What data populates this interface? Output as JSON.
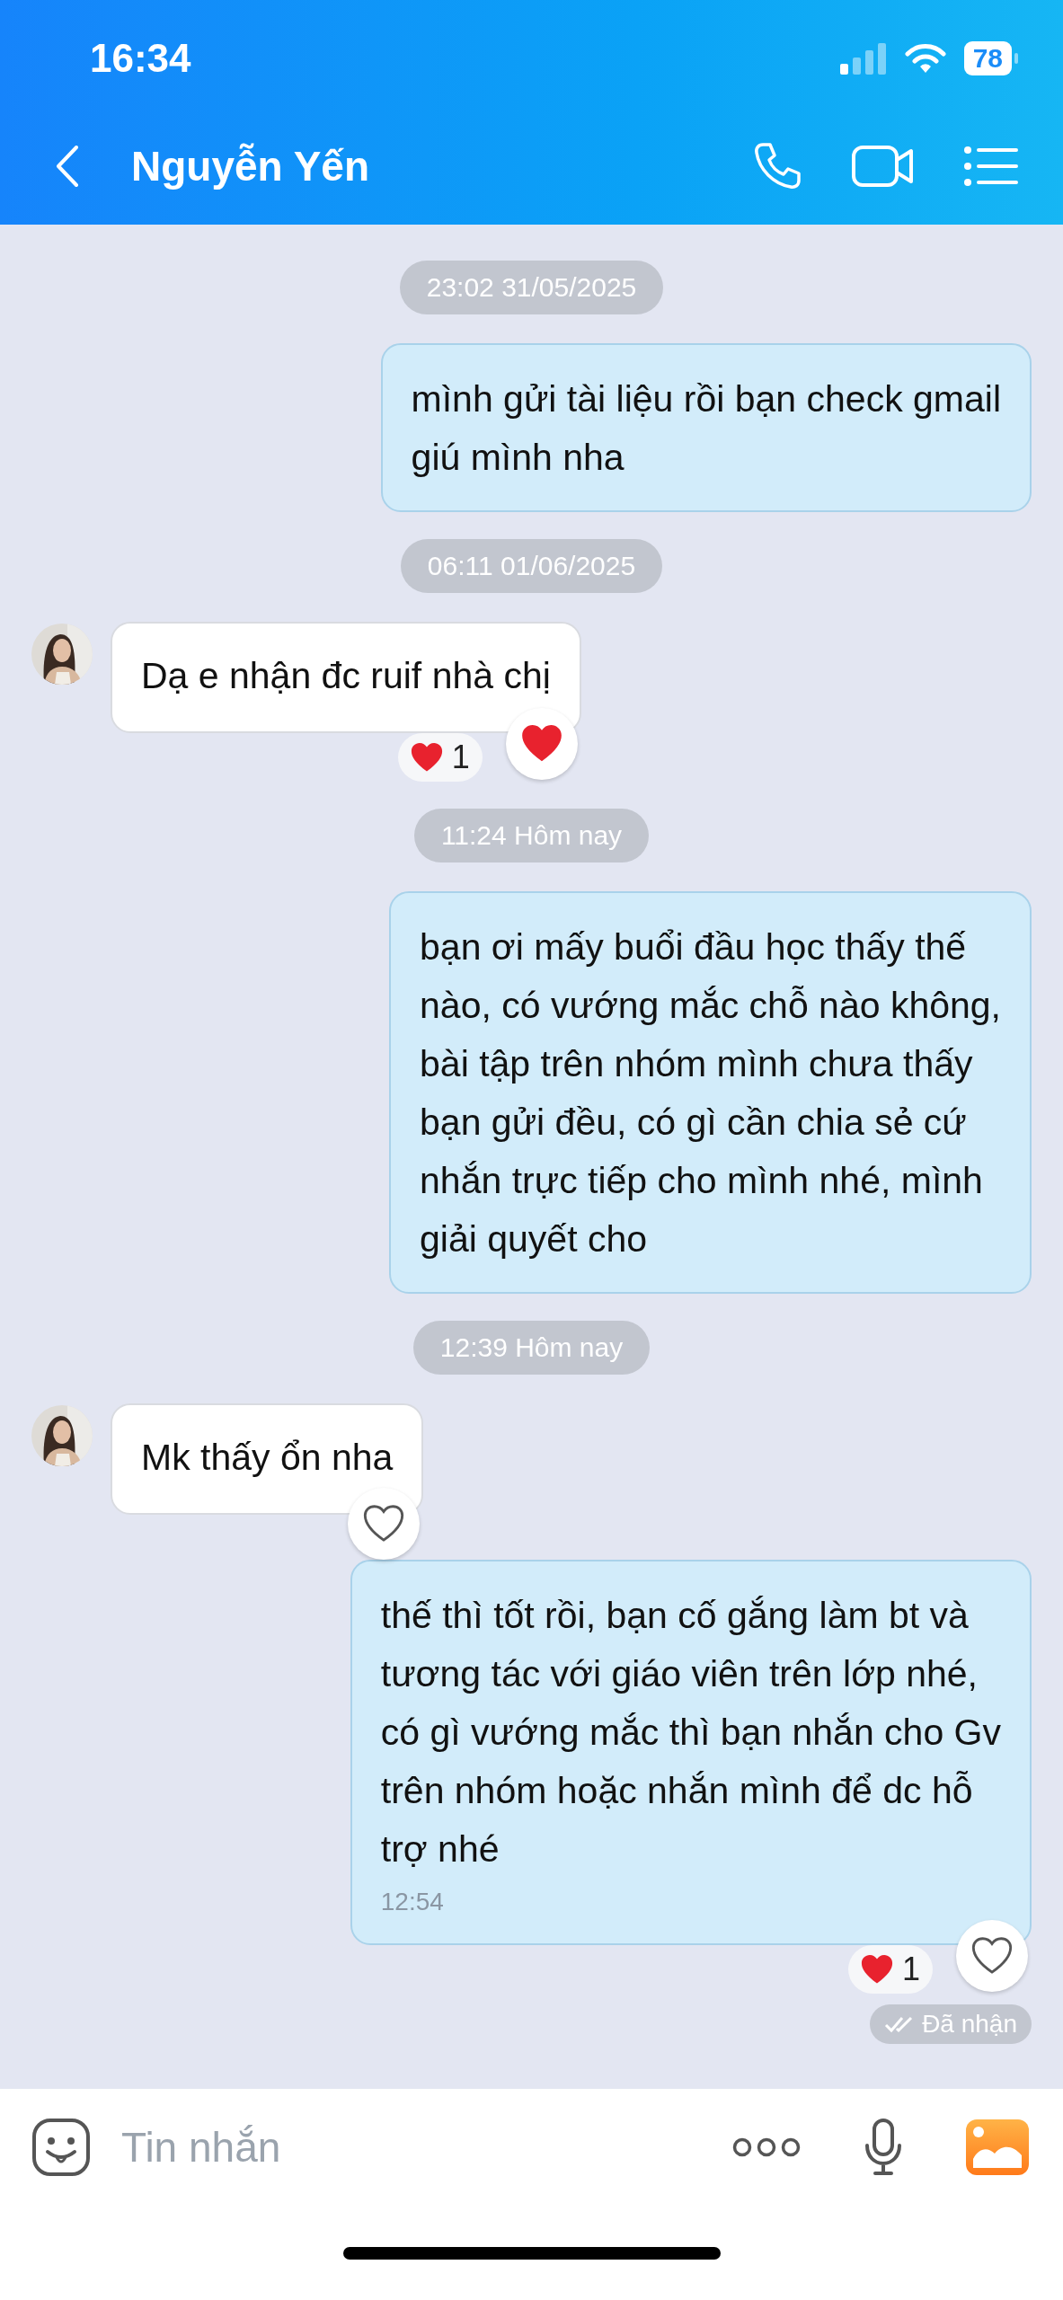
{
  "status_bar": {
    "time": "16:34",
    "battery": "78"
  },
  "header": {
    "title": "Nguyễn Yến"
  },
  "messages": [
    {
      "kind": "date",
      "text": "23:02 31/05/2025"
    },
    {
      "kind": "outgoing",
      "text": "mình gửi tài liệu rồi bạn check gmail\ngiú mình nha"
    },
    {
      "kind": "date",
      "text": "06:11 01/06/2025"
    },
    {
      "kind": "incoming",
      "text": "Dạ e nhận đc ruif nhà chị",
      "reaction_count": "1",
      "reacted": true
    },
    {
      "kind": "date",
      "text": "11:24 Hôm nay"
    },
    {
      "kind": "outgoing",
      "text": "bạn ơi mấy buổi đầu học thấy thế\nnào, có vướng mắc chỗ nào không,\nbài tập trên nhóm mình chưa thấy\nbạn gửi đều, có gì cần chia sẻ cứ\nnhắn trực tiếp cho mình nhé, mình\ngiải quyết cho"
    },
    {
      "kind": "date",
      "text": "12:39 Hôm nay"
    },
    {
      "kind": "incoming",
      "text": "Mk thấy ổn nha",
      "reacted": false
    },
    {
      "kind": "outgoing",
      "text": "thế thì tốt rồi, bạn cố gắng làm bt và\ntương tác với giáo viên trên lớp nhé,\ncó gì vướng mắc thì bạn nhắn cho Gv\ntrên nhóm hoặc nhắn mình để dc hỗ\ntrợ nhé",
      "time": "12:54",
      "reaction_count": "1",
      "reacted": false,
      "status": "Đã nhận"
    }
  ],
  "composer": {
    "placeholder": "Tin nhắn"
  }
}
